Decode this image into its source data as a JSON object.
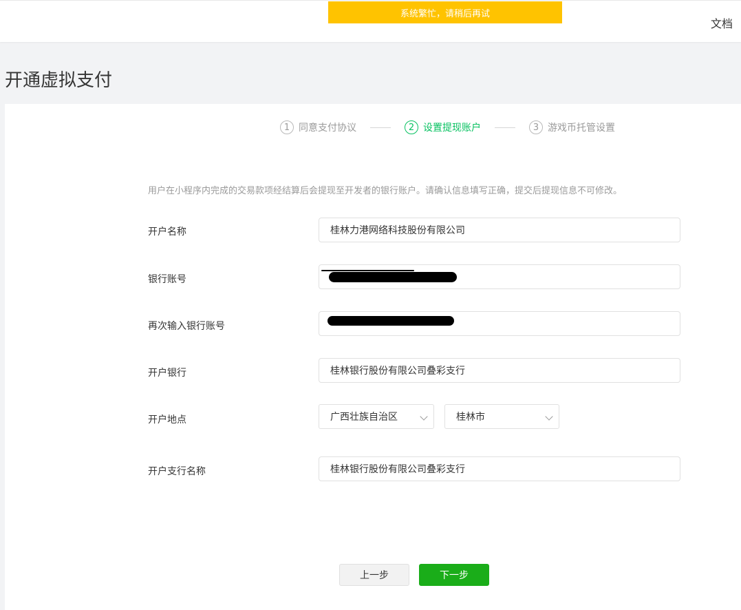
{
  "header": {
    "toast": "系统繁忙，请稍后再试",
    "docs_link": "文档"
  },
  "page": {
    "title": "开通虚拟支付"
  },
  "steps": [
    {
      "number": "1",
      "label": "同意支付协议",
      "active": false
    },
    {
      "number": "2",
      "label": "设置提现账户",
      "active": true
    },
    {
      "number": "3",
      "label": "游戏币托管设置",
      "active": false
    }
  ],
  "form": {
    "description": "用户在小程序内完成的交易款项经结算后会提现至开发者的银行账户。请确认信息填写正确，提交后提现信息不可修改。",
    "account_name_label": "开户名称",
    "account_name_value": "桂林力港网络科技股份有限公司",
    "bank_account_label": "银行账号",
    "bank_account_confirm_label": "再次输入银行账号",
    "bank_label": "开户银行",
    "bank_value": "桂林银行股份有限公司叠彩支行",
    "location_label": "开户地点",
    "province_value": "广西壮族自治区",
    "city_value": "桂林市",
    "branch_label": "开户支行名称",
    "branch_value": "桂林银行股份有限公司叠彩支行"
  },
  "buttons": {
    "prev": "上一步",
    "next": "下一步"
  },
  "colors": {
    "accent_green": "#07c160",
    "button_green": "#1aad19",
    "toast_yellow": "#ffc300"
  }
}
